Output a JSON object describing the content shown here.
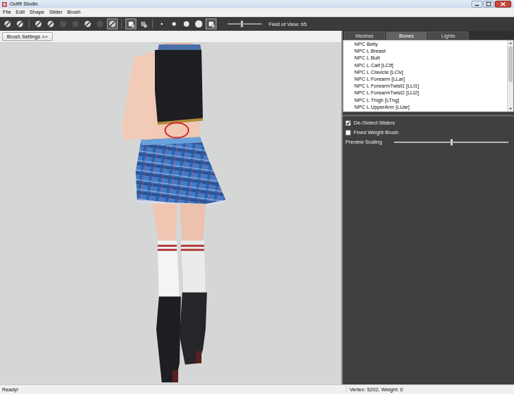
{
  "window": {
    "title": "Outfit Studio"
  },
  "menu": [
    "File",
    "Edit",
    "Shape",
    "Slider",
    "Brush"
  ],
  "toolbar": {
    "tools": [
      {
        "kind": "tool",
        "selected": false,
        "disabled": false
      },
      {
        "kind": "tool",
        "selected": false,
        "disabled": false
      },
      {
        "kind": "sep",
        "selected": false,
        "disabled": false
      },
      {
        "kind": "tool",
        "selected": false,
        "disabled": false
      },
      {
        "kind": "tool",
        "selected": false,
        "disabled": false
      },
      {
        "kind": "tool",
        "selected": false,
        "disabled": true
      },
      {
        "kind": "tool",
        "selected": false,
        "disabled": true
      },
      {
        "kind": "tool",
        "selected": false,
        "disabled": false
      },
      {
        "kind": "tool",
        "selected": false,
        "disabled": true
      },
      {
        "kind": "tool",
        "selected": true,
        "disabled": false
      },
      {
        "kind": "sep",
        "selected": false,
        "disabled": false
      },
      {
        "kind": "toggle",
        "selected": true,
        "disabled": false
      },
      {
        "kind": "toggle",
        "selected": false,
        "disabled": false
      },
      {
        "kind": "sep",
        "selected": false,
        "disabled": false
      },
      {
        "kind": "size",
        "selected": false,
        "disabled": false
      },
      {
        "kind": "size",
        "selected": false,
        "disabled": false
      },
      {
        "kind": "size",
        "selected": false,
        "disabled": false
      },
      {
        "kind": "size",
        "selected": false,
        "disabled": false
      },
      {
        "kind": "toggle",
        "selected": true,
        "disabled": false
      }
    ],
    "field_of_view": {
      "label": "Field of View: 65",
      "level": 0.42
    }
  },
  "brush_settings": {
    "label": "Brush Settings >>"
  },
  "tabs": [
    {
      "label": "Meshes",
      "selected": false
    },
    {
      "label": "Bones",
      "selected": true
    },
    {
      "label": "Lights",
      "selected": false
    }
  ],
  "bones": {
    "items": [
      {
        "label": "NPC Belly",
        "selected": false
      },
      {
        "label": "NPC L Breast",
        "selected": false
      },
      {
        "label": "NPC L Butt",
        "selected": false
      },
      {
        "label": "NPC L Calf [LClf]",
        "selected": false
      },
      {
        "label": "NPC L Clavicle [LClv]",
        "selected": false
      },
      {
        "label": "NPC L Forearm [LLar]",
        "selected": false
      },
      {
        "label": "NPC L ForearmTwist1 [LLt1]",
        "selected": false
      },
      {
        "label": "NPC L ForearmTwist2 [LLt2]",
        "selected": false
      },
      {
        "label": "NPC L Thigh [LThg]",
        "selected": false
      },
      {
        "label": "NPC L UpperArm [LUar]",
        "selected": false
      }
    ]
  },
  "options": [
    {
      "kind": "checkbox",
      "label": "De-/Select Sliders",
      "checked": true,
      "level": 0
    },
    {
      "kind": "checkbox",
      "label": "Fixed Weight Brush",
      "checked": false,
      "level": 0
    },
    {
      "kind": "slider",
      "label": "Preview Scaling",
      "checked": false,
      "level": 0.5
    }
  ],
  "status_bar": {
    "message": "Ready!",
    "vertex": "Vertex: 5202, Weight: 0"
  }
}
